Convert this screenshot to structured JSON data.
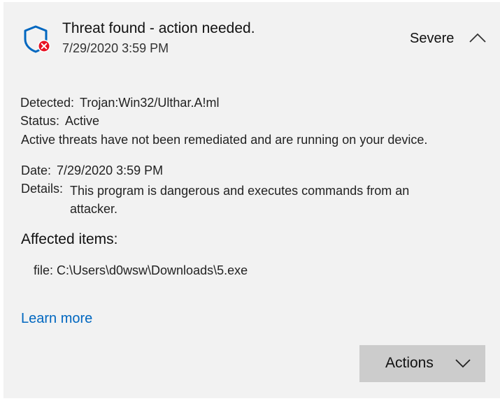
{
  "header": {
    "title": "Threat found - action needed.",
    "timestamp": "7/29/2020 3:59 PM",
    "severity": "Severe",
    "icon": "shield-error-icon",
    "collapse_icon": "chevron-up-icon"
  },
  "detected": {
    "label": "Detected:",
    "value": "Trojan:Win32/Ulthar.A!ml"
  },
  "status": {
    "label": "Status:",
    "value": "Active"
  },
  "status_note": "Active threats have not been remediated and are running on your device.",
  "date": {
    "label": "Date:",
    "value": "7/29/2020 3:59 PM"
  },
  "details": {
    "label": "Details:",
    "value": "This program is dangerous and executes commands from an attacker."
  },
  "affected": {
    "heading": "Affected items:",
    "items": [
      "file: C:\\Users\\d0wsw\\Downloads\\5.exe"
    ]
  },
  "learn_more": "Learn more",
  "actions": {
    "label": "Actions",
    "icon": "chevron-down-icon"
  },
  "colors": {
    "accent": "#0067c0",
    "shield": "#0067c0",
    "error": "#e81123",
    "card_background": "#f2f2f2",
    "button_background": "#cccccc"
  }
}
